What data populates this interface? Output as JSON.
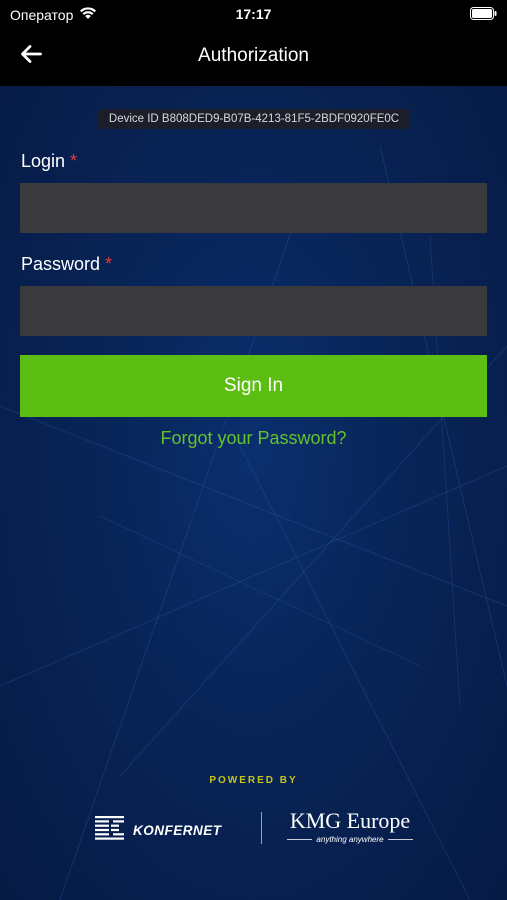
{
  "status_bar": {
    "carrier": "Оператор",
    "time": "17:17",
    "icons": [
      "wifi-icon",
      "battery-icon"
    ]
  },
  "nav": {
    "title": "Authorization",
    "back_icon": "arrow-left-icon"
  },
  "device_id": {
    "text": "Device ID B808DED9-B07B-4213-81F5-2BDF0920FE0C"
  },
  "form": {
    "login": {
      "label": "Login",
      "required_mark": "*",
      "value": ""
    },
    "password": {
      "label": "Password",
      "required_mark": "*",
      "value": ""
    },
    "sign_in_label": "Sign In",
    "forgot_label": "Forgot your Password?"
  },
  "footer": {
    "powered_by": "POWERED BY",
    "partners": [
      {
        "name": "KONFERNET",
        "icon": "konfernet-k-logo-icon"
      },
      {
        "name": "KMG Europe",
        "tagline": "anything anywhere"
      }
    ]
  },
  "colors": {
    "accent_green": "#5cbd13",
    "link_green": "#63c22b",
    "required_red": "#e63b3b",
    "background_blue": "#082457",
    "input_gray": "#3a3a3c",
    "powered_by_yellow": "#c4c41c"
  }
}
